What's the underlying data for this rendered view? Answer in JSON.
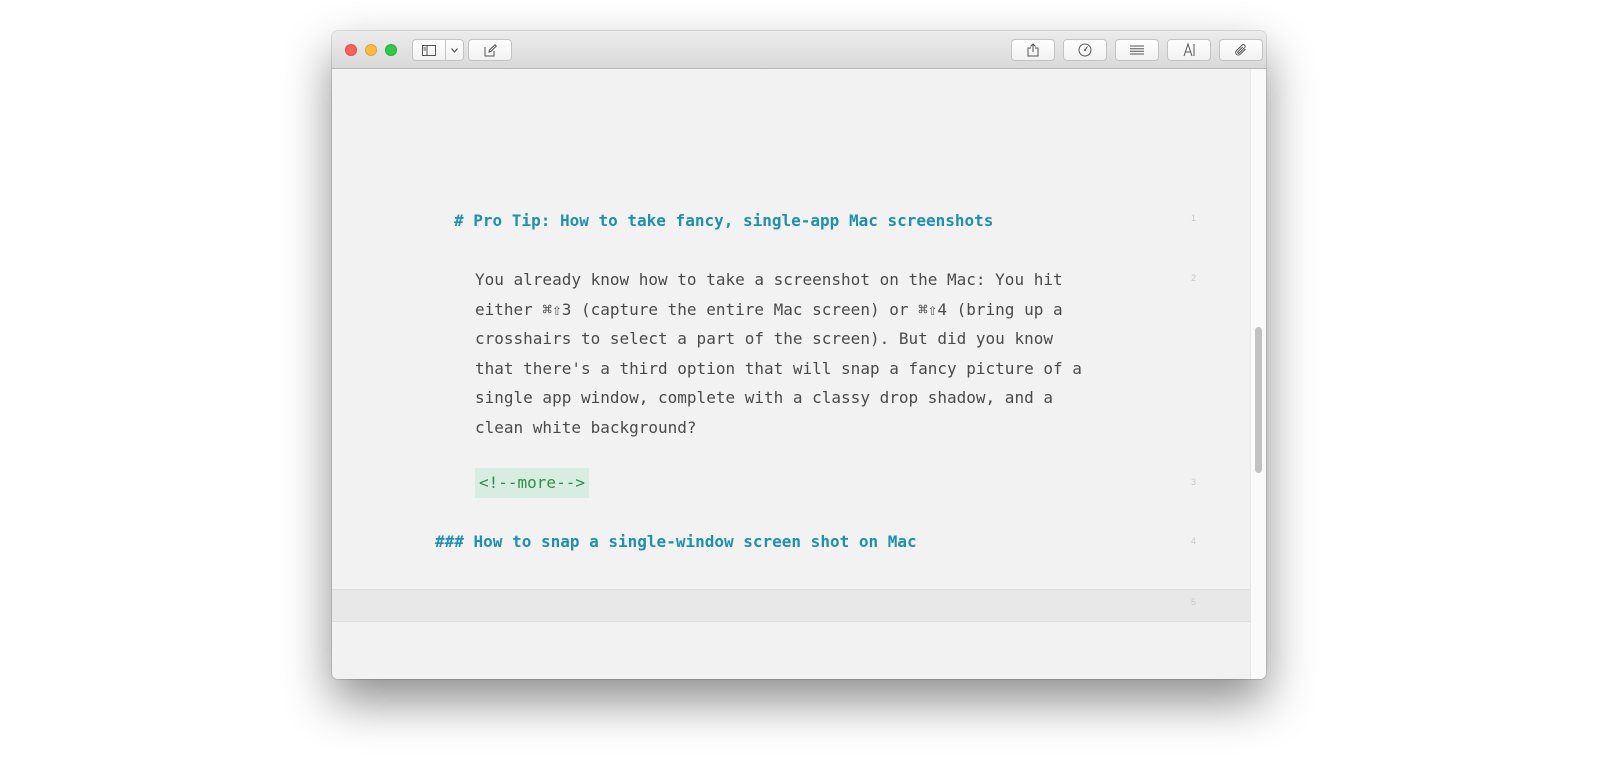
{
  "toolbar": {
    "left_icons": [
      "sidebar-icon",
      "chevron-down-icon",
      "compose-icon"
    ],
    "right_icons": [
      "share-icon",
      "stats-icon",
      "list-icon",
      "font-icon",
      "paperclip-icon"
    ]
  },
  "document": {
    "heading1": "# Pro Tip: How to take fancy, single-app Mac screenshots",
    "paragraph_lines": [
      "You already know how to take a screenshot on the Mac: You hit",
      "either ⌘⇧3 (capture the entire Mac screen) or ⌘⇧4 (bring up a",
      "crosshairs to select a part of the screen). But did you know",
      "that there's a third option that will snap a fancy picture of a",
      "single app window, complete with a classy drop shadow, and a",
      "clean white background?"
    ],
    "comment": "<!--more-->",
    "heading3": "### How to snap a single-window screen shot on Mac",
    "line_numbers": [
      "1",
      "2",
      "3",
      "4",
      "5"
    ]
  },
  "colors": {
    "heading": "#1e8fb5",
    "body_text": "#4a4a4a",
    "comment_text": "#2f8f47",
    "comment_bg": "#d8ede1"
  }
}
